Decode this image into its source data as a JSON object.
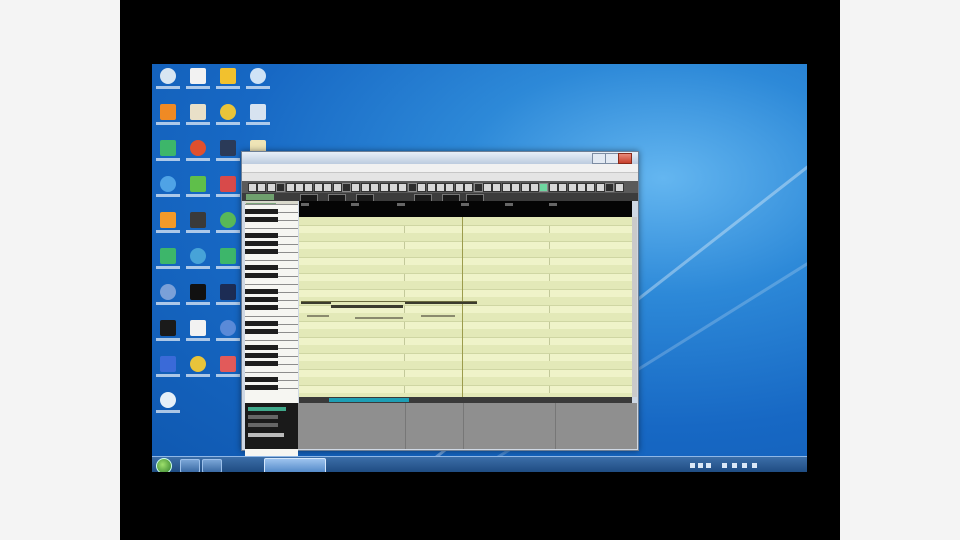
{
  "desktop": {
    "icons": [
      {
        "name": "recycle-bin-icon",
        "color": "#d8e6f2"
      },
      {
        "name": "document-icon",
        "color": "#f2f2f2"
      },
      {
        "name": "smiley-app-icon",
        "color": "#f2c12e"
      },
      {
        "name": "shortcut-icon",
        "color": "#cfe3f6"
      },
      {
        "name": "orange-app-icon",
        "color": "#f08a24"
      },
      {
        "name": "picture-icon",
        "color": "#e9e0c8"
      },
      {
        "name": "paint-app-icon",
        "color": "#e9c43a"
      },
      {
        "name": "tool-icon",
        "color": "#d7e3f0"
      },
      {
        "name": "chrome-icon",
        "color": "#3db66a"
      },
      {
        "name": "red-app-icon",
        "color": "#e0502e"
      },
      {
        "name": "steam-icon",
        "color": "#2a3a58"
      },
      {
        "name": "file-icon",
        "color": "#efe4b6"
      },
      {
        "name": "ie-icon",
        "color": "#4fa3e6"
      },
      {
        "name": "green-app-icon",
        "color": "#5fbf4a"
      },
      {
        "name": "grid-app-icon",
        "color": "#d84a4a"
      },
      {
        "name": "globe-icon",
        "color": "#e85a2a"
      },
      {
        "name": "orange-ball-icon",
        "color": "#f39a2a"
      },
      {
        "name": "dark-app-icon",
        "color": "#3a3a3a"
      },
      {
        "name": "refresh-icon",
        "color": "#58b858"
      },
      {
        "name": "blue-swirl-icon",
        "color": "#3b7bd6"
      },
      {
        "name": "chrome-alt-icon",
        "color": "#3db66a"
      },
      {
        "name": "utility-icon",
        "color": "#47a3d8"
      },
      {
        "name": "chrome-2-icon",
        "color": "#3db66a"
      },
      {
        "name": "orange-globe-icon",
        "color": "#e87e2a"
      },
      {
        "name": "media-icon",
        "color": "#7aa0d8"
      },
      {
        "name": "black-app-icon",
        "color": "#111111"
      },
      {
        "name": "dark-blue-app-icon",
        "color": "#1c2c54"
      },
      {
        "name": "red-square-icon",
        "color": "#d2282a"
      },
      {
        "name": "black-logo-icon",
        "color": "#1a1a1a"
      },
      {
        "name": "paper-icon",
        "color": "#f2f2f2"
      },
      {
        "name": "blue-gear-icon",
        "color": "#5a8ad8"
      },
      {
        "name": "editor-icon",
        "color": "#2d6ad0"
      },
      {
        "name": "blue-letter-icon",
        "color": "#3a6ad8"
      },
      {
        "name": "yellow-folder-icon",
        "color": "#e9c43a"
      },
      {
        "name": "mail-icon",
        "color": "#e25a5a"
      },
      {
        "name": "cloud-icon",
        "color": "#9ac4ee"
      },
      {
        "name": "notepad-icon",
        "color": "#e6f0f8"
      }
    ]
  },
  "app": {
    "title": "",
    "menu": [
      "",
      "",
      "",
      "",
      "",
      "",
      "",
      ""
    ],
    "logo": ""
  },
  "taskbar": {
    "clock_time": "",
    "clock_date": ""
  }
}
